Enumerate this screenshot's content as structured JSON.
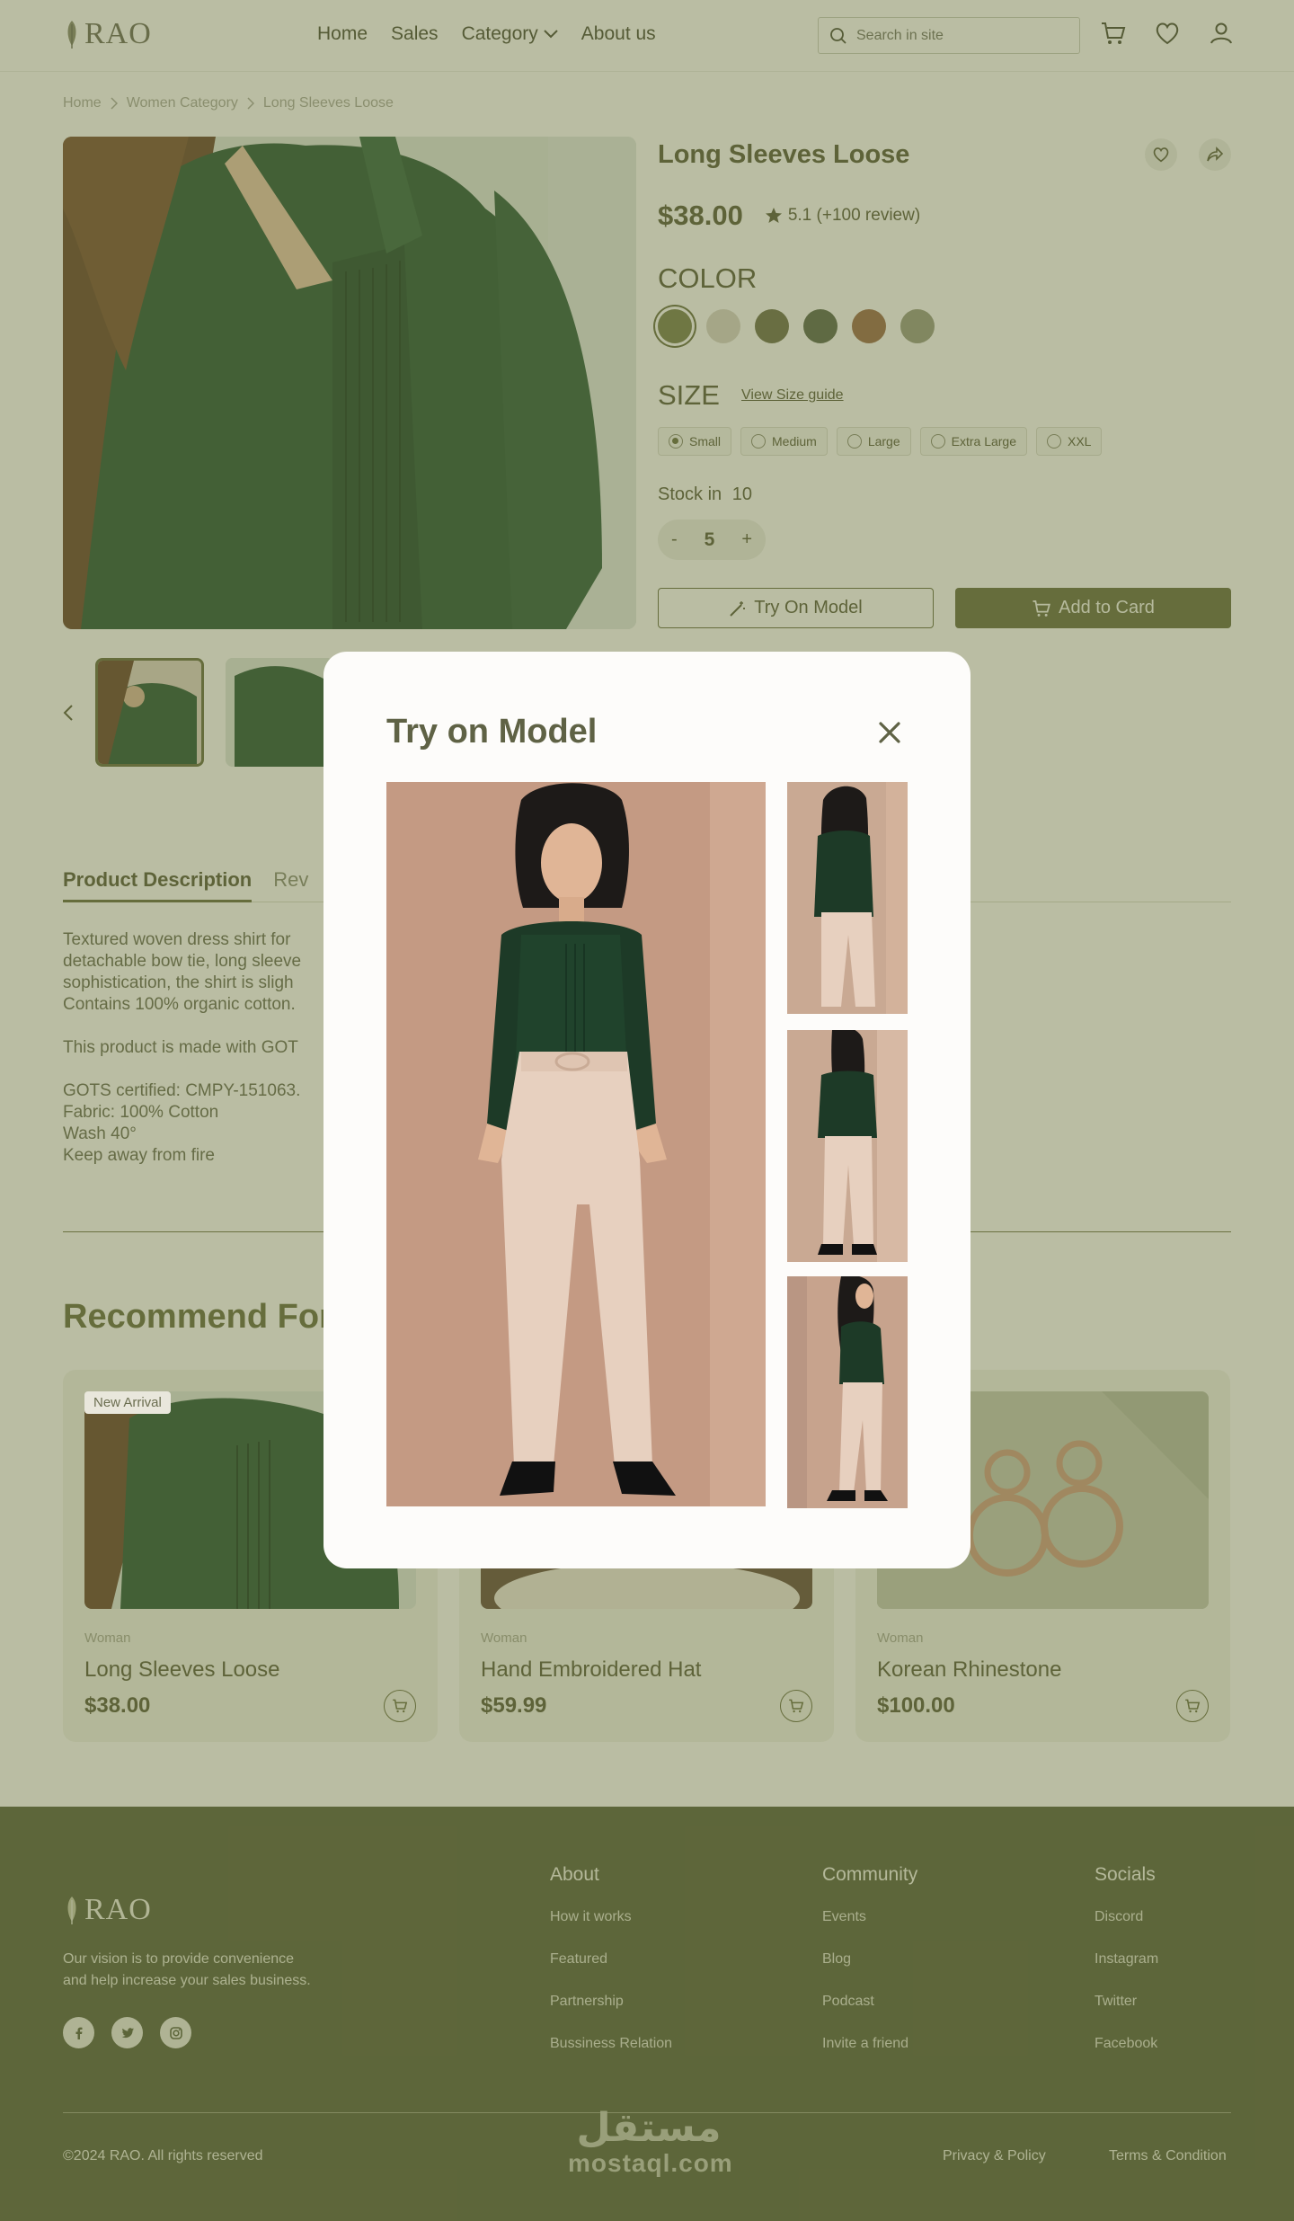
{
  "header": {
    "logo": "RAO",
    "nav": [
      "Home",
      "Sales",
      "Category",
      "About us"
    ],
    "search_placeholder": "Search in site"
  },
  "breadcrumb": [
    "Home",
    "Women Category",
    "Long Sleeves Loose"
  ],
  "product": {
    "title": "Long Sleeves Loose",
    "price": "$38.00",
    "rating": "5.1 (+100 review)",
    "color_label": "COLOR",
    "colors": [
      "#7b8152",
      "#d7d3c6",
      "#707350",
      "#5f6b51",
      "#9c6f4f",
      "#9a9d84"
    ],
    "size_label": "SIZE",
    "size_guide": "View Size guide",
    "sizes": [
      "Small",
      "Medium",
      "Large",
      "Extra Large",
      "XXL"
    ],
    "selected_size": "Small",
    "stock_label": "Stock in",
    "stock": "10",
    "qty_minus": "-",
    "qty": "5",
    "qty_plus": "+",
    "try_on": "Try On Model",
    "add_to_cart": "Add to Card",
    "partial_link": "y"
  },
  "tabs": [
    "Product Description",
    "Rev"
  ],
  "description": [
    "Textured woven dress shirt for",
    "detachable bow tie, long sleeve",
    "sophistication, the shirt is sligh",
    "Contains 100% organic cotton.",
    "",
    "This product is made with GOT",
    "",
    "GOTS certified: CMPY-151063.",
    "Fabric: 100% Cotton",
    "Wash 40°",
    "Keep away from fire"
  ],
  "recommend_title": "Recommend For",
  "cards": [
    {
      "badge": "New Arrival",
      "category": "Woman",
      "name": "Long Sleeves Loose",
      "price": "$38.00"
    },
    {
      "badge": "",
      "category": "Woman",
      "name": "Hand Embroidered Hat",
      "price": "$59.99"
    },
    {
      "badge": "",
      "category": "Woman",
      "name": "Korean Rhinestone",
      "price": "$100.00"
    }
  ],
  "footer": {
    "logo": "RAO",
    "vision_line1": "Our vision is to provide convenience",
    "vision_line2": "and help increase your sales business.",
    "columns": [
      {
        "title": "About",
        "links": [
          "How it works",
          "Featured",
          "Partnership",
          "Bussiness Relation"
        ]
      },
      {
        "title": "Community",
        "links": [
          "Events",
          "Blog",
          "Podcast",
          "Invite a friend"
        ]
      },
      {
        "title": "Socials",
        "links": [
          "Discord",
          "Instagram",
          "Twitter",
          "Facebook"
        ]
      }
    ],
    "copyright": "©2024 RAO. All rights reserved",
    "privacy": "Privacy & Policy",
    "terms": "Terms & Condition",
    "watermark_ar": "مستقل",
    "watermark_en": "mostaql.com"
  },
  "modal": {
    "title": "Try on Model"
  },
  "colors": {
    "accent": "#6b7045",
    "footer_bg": "#5c6442",
    "overlay": "#606830"
  }
}
